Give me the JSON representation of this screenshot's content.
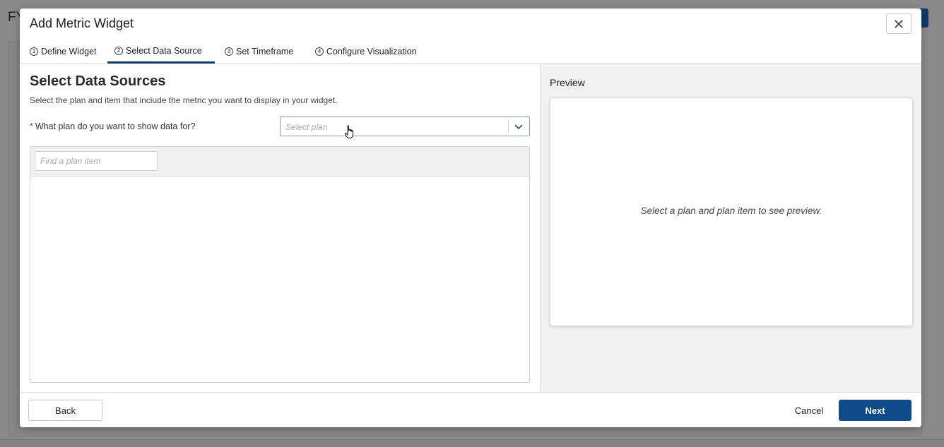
{
  "background": {
    "title_partial": "FY"
  },
  "modal": {
    "title": "Add Metric Widget",
    "close_label": "×"
  },
  "tabs": [
    {
      "num": "1",
      "label": "Define Widget",
      "active": false
    },
    {
      "num": "2",
      "label": "Select Data Source",
      "active": true
    },
    {
      "num": "3",
      "label": "Set Timeframe",
      "active": false
    },
    {
      "num": "4",
      "label": "Configure Visualization",
      "active": false
    }
  ],
  "data_source": {
    "title": "Select Data Sources",
    "description": "Select the plan and item that include the metric you want to display in your widget.",
    "plan_question_required": "*",
    "plan_question": "What plan do you want to show data for?",
    "plan_select_placeholder": "Select plan",
    "plan_select_value": "",
    "find_item_placeholder": "Find a plan item",
    "find_item_value": ""
  },
  "preview": {
    "title": "Preview",
    "empty_message": "Select a plan and plan item to see preview."
  },
  "footer": {
    "back_label": "Back",
    "cancel_label": "Cancel",
    "next_label": "Next"
  },
  "colors": {
    "primary": "#0f4a8a",
    "active_tab_underline": "#0f3a66",
    "required_marker": "#1a5aa6",
    "overlay": "#8a8a8a"
  },
  "icons": {
    "close": "close-icon",
    "select_chevron": "chevron-down-icon",
    "pointer": "hand-pointer-icon"
  }
}
